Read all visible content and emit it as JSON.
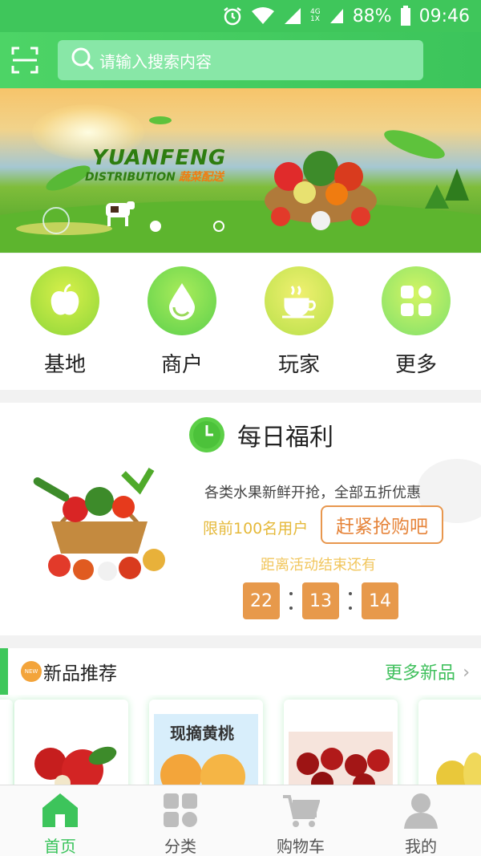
{
  "status_bar": {
    "network_label": "4G",
    "sim_label": "1X",
    "battery": "88%",
    "time": "09:46",
    "icons": [
      "alarm-icon",
      "wifi-icon",
      "signal-icon",
      "signal-icon",
      "battery-icon"
    ]
  },
  "header": {
    "scan_icon": "scan-icon",
    "search_placeholder": "请输入搜索内容"
  },
  "banner": {
    "brand": "YUANFENG",
    "brand_sub": "DISTRIBUTION",
    "brand_cn": "蔬菜配送",
    "slide_index": 1,
    "slide_count": 2
  },
  "quick_nav": [
    {
      "label": "基地",
      "icon": "apple-icon"
    },
    {
      "label": "商户",
      "icon": "drop-icon"
    },
    {
      "label": "玩家",
      "icon": "coffee-icon"
    },
    {
      "label": "更多",
      "icon": "grid-icon"
    }
  ],
  "daily": {
    "title": "每日福利",
    "description": "各类水果新鲜开抢，全部五折优惠",
    "limit": "限前100名用户",
    "buy_button": "赶紧抢购吧",
    "countdown_label": "距离活动结束还有",
    "hours": "22",
    "minutes": "13",
    "seconds": "14"
  },
  "new_products": {
    "badge": "NEW",
    "title": "新品推荐",
    "more": "更多新品",
    "cards": [
      {
        "image": "apples"
      },
      {
        "image": "peaches",
        "caption": "现摘黄桃"
      },
      {
        "image": "dates"
      },
      {
        "image": "pears"
      }
    ]
  },
  "tabbar": [
    {
      "label": "首页",
      "icon": "home-icon",
      "active": true
    },
    {
      "label": "分类",
      "icon": "category-icon",
      "active": false
    },
    {
      "label": "购物车",
      "icon": "cart-icon",
      "active": false
    },
    {
      "label": "我的",
      "icon": "profile-icon",
      "active": false
    }
  ],
  "colors": {
    "primary_green": "#3fc65b",
    "orange_accent": "#e7994b",
    "yellow_text": "#e5b93a"
  }
}
